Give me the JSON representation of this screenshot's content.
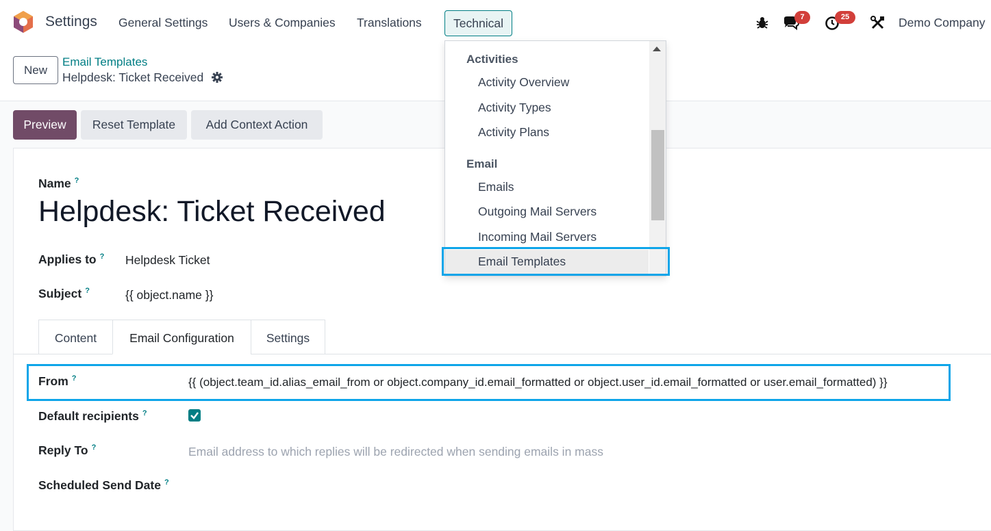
{
  "navbar": {
    "app_name": "Settings",
    "menu": [
      "General Settings",
      "Users & Companies",
      "Translations",
      "Technical"
    ],
    "messages_count": "7",
    "activities_count": "25",
    "company": "Demo Company"
  },
  "control_panel": {
    "new_label": "New",
    "breadcrumb_parent": "Email Templates",
    "breadcrumb_current": "Helpdesk: Ticket Received"
  },
  "actions": {
    "preview": "Preview",
    "reset_template": "Reset Template",
    "add_context_action": "Add Context Action"
  },
  "form": {
    "name_label": "Name",
    "name_value": "Helpdesk: Ticket Received",
    "applies_to_label": "Applies to",
    "applies_to_value": "Helpdesk Ticket",
    "subject_label": "Subject",
    "subject_value": "{{ object.name }}",
    "help_mark": "?",
    "tabs": [
      "Content",
      "Email Configuration",
      "Settings"
    ],
    "active_tab": "Email Configuration",
    "from_label": "From",
    "from_value": "{{ (object.team_id.alias_email_from or object.company_id.email_formatted or object.user_id.email_formatted or user.email_formatted) }}",
    "default_recipients_label": "Default recipients",
    "default_recipients_checked": true,
    "reply_to_label": "Reply To",
    "reply_to_placeholder": "Email address to which replies will be redirected when sending emails in mass",
    "scheduled_send_date_label": "Scheduled Send Date"
  },
  "dropdown": {
    "sections": [
      {
        "title": "Activities",
        "items": [
          "Activity Overview",
          "Activity Types",
          "Activity Plans"
        ]
      },
      {
        "title": "Email",
        "items": [
          "Emails",
          "Outgoing Mail Servers",
          "Incoming Mail Servers",
          "Email Templates"
        ]
      }
    ],
    "highlighted_item": "Email Templates"
  },
  "colors": {
    "brand": "#714b67",
    "accent": "#017e84",
    "highlight_box": "#0ea5e9",
    "badge": "#d23f3a"
  }
}
